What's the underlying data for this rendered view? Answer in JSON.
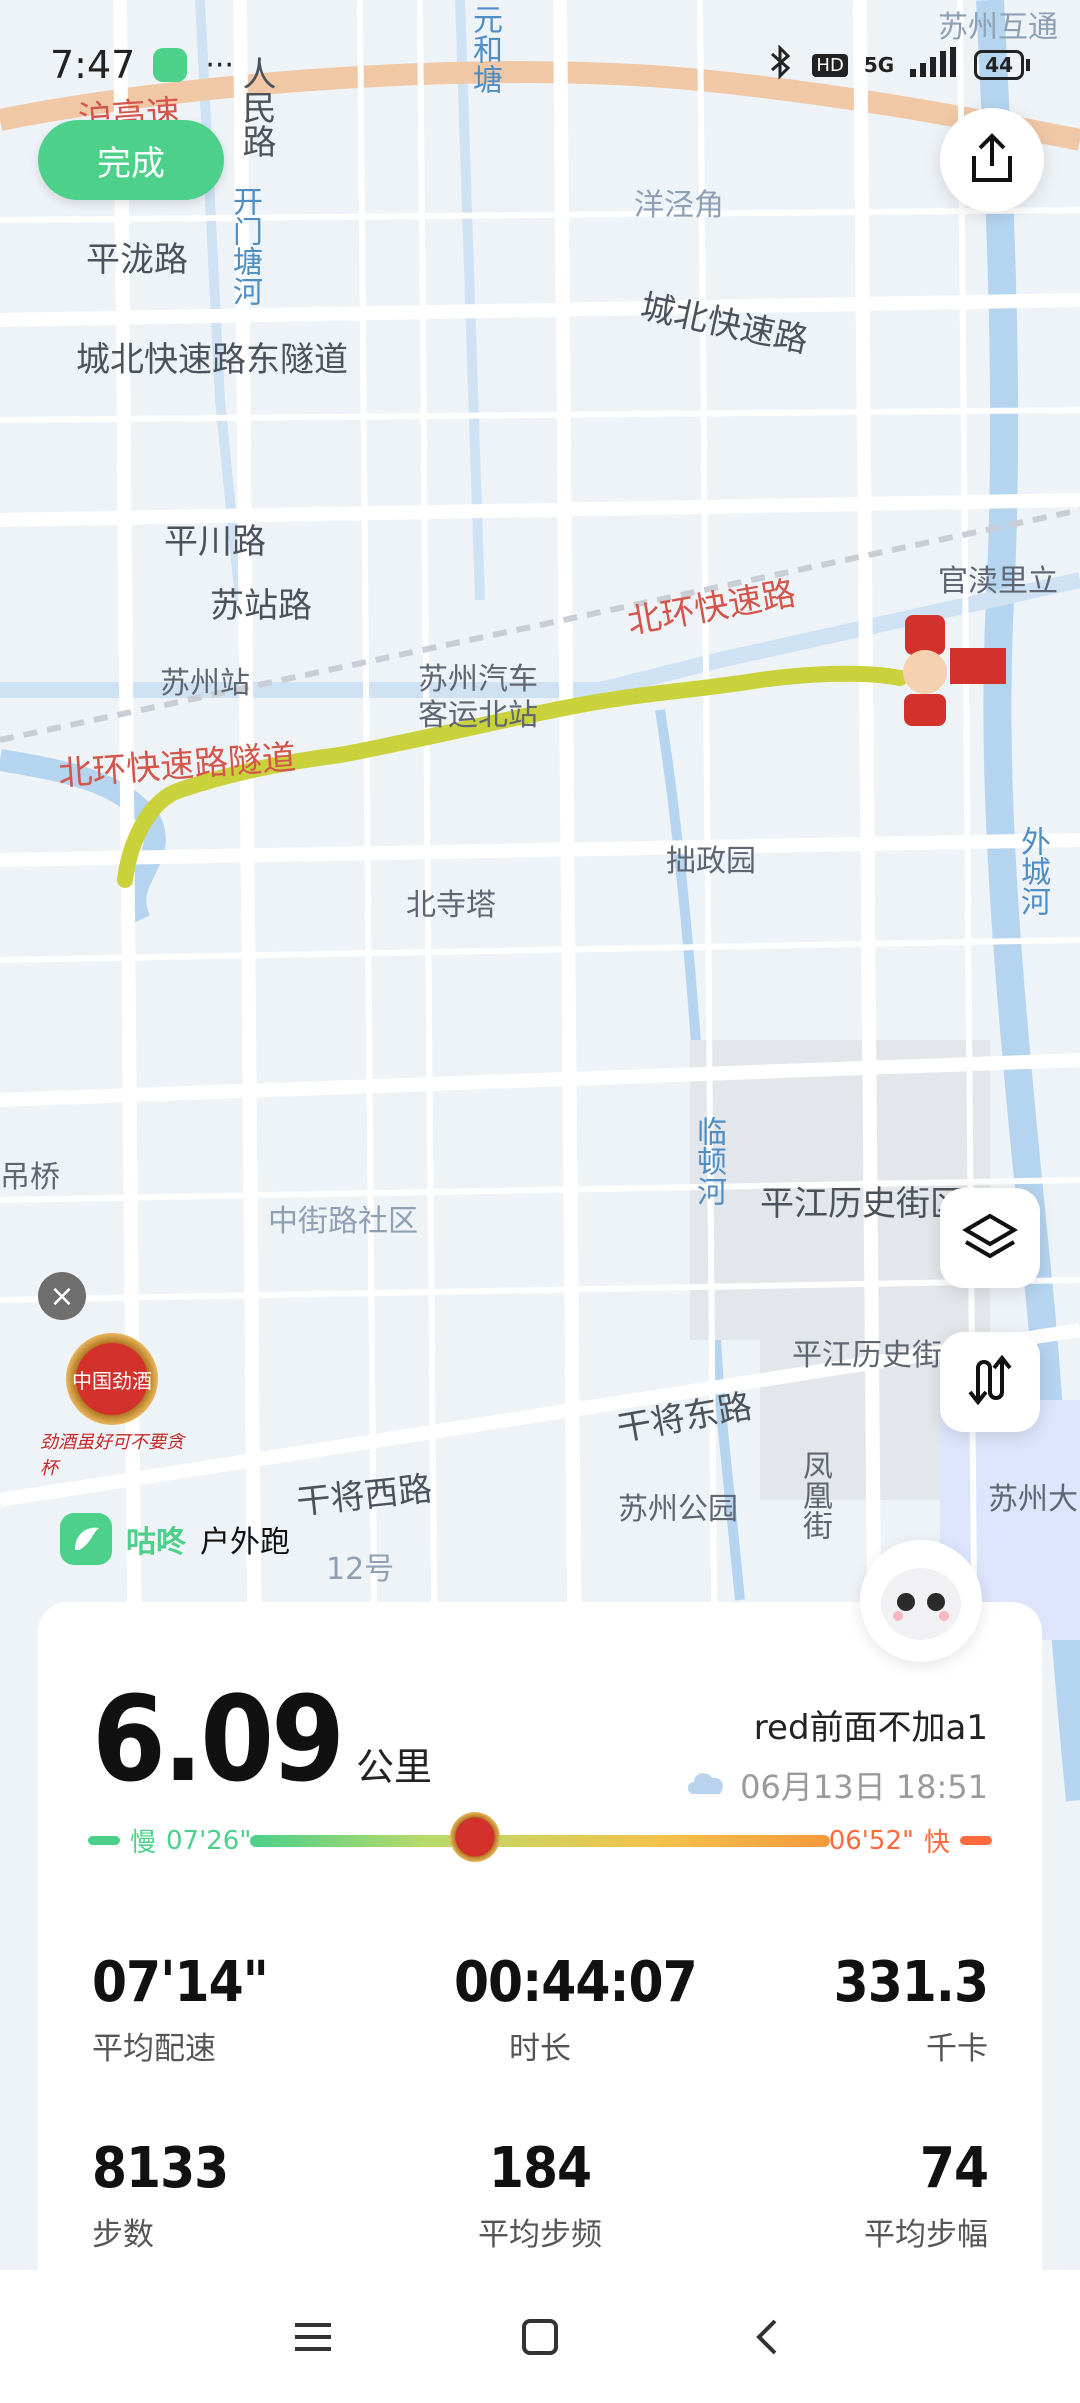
{
  "status_bar": {
    "time": "7:47",
    "more": "···",
    "network": "5G",
    "hd": "HD",
    "battery": "44"
  },
  "actions": {
    "done_label": "完成"
  },
  "map": {
    "labels": [
      {
        "id": "l1",
        "text": "苏州互通"
      },
      {
        "id": "l2",
        "text": "元和塘"
      },
      {
        "id": "l3",
        "text": "沪高速"
      },
      {
        "id": "l4",
        "text": "人民路"
      },
      {
        "id": "l5",
        "text": "开门塘河"
      },
      {
        "id": "l6",
        "text": "洋泾角"
      },
      {
        "id": "l7",
        "text": "平泷路"
      },
      {
        "id": "l8",
        "text": "城北快速路"
      },
      {
        "id": "l9",
        "text": "城北快速路东隧道"
      },
      {
        "id": "l10",
        "text": "平川路"
      },
      {
        "id": "l11",
        "text": "苏站路"
      },
      {
        "id": "l12",
        "text": "官渎里立"
      },
      {
        "id": "l13",
        "text": "北环快速路"
      },
      {
        "id": "l14",
        "text": "苏州站"
      },
      {
        "id": "l15",
        "text": "苏州汽车"
      },
      {
        "id": "l16",
        "text": "客运北站"
      },
      {
        "id": "l17",
        "text": "北环快速路隧道"
      },
      {
        "id": "l18",
        "text": "拙政园"
      },
      {
        "id": "l19",
        "text": "外城河"
      },
      {
        "id": "l20",
        "text": "北寺塔"
      },
      {
        "id": "l21",
        "text": "临顿河"
      },
      {
        "id": "l22",
        "text": "平江历史街区"
      },
      {
        "id": "l23",
        "text": "中街路社区"
      },
      {
        "id": "l24",
        "text": "平江历史街"
      },
      {
        "id": "l25",
        "text": "干将东路"
      },
      {
        "id": "l26",
        "text": "干将西路"
      },
      {
        "id": "l27",
        "text": "苏州公园"
      },
      {
        "id": "l28",
        "text": "凤凰街"
      },
      {
        "id": "l29",
        "text": "苏州大"
      },
      {
        "id": "l30",
        "text": "吊桥"
      },
      {
        "id": "l31",
        "text": "12号"
      }
    ]
  },
  "ad": {
    "badge_text": "中国劲酒",
    "slogan": "劲酒虽好可不要贪杯"
  },
  "brand": {
    "name": "咕咚",
    "mode": "户外跑"
  },
  "summary": {
    "distance": "6.09",
    "distance_unit": "公里",
    "run_title": "red前面不加a1",
    "date": "06月13日 18:51",
    "pace_slow_label": "慢",
    "pace_slow_value": "07'26\"",
    "pace_fast_label": "快",
    "pace_fast_value": "06'52\""
  },
  "stats": [
    {
      "value": "07'14\"",
      "label": "平均配速"
    },
    {
      "value": "00:44:07",
      "label": "时长"
    },
    {
      "value": "331.3",
      "label": "千卡"
    },
    {
      "value": "8133",
      "label": "步数"
    },
    {
      "value": "184",
      "label": "平均步频"
    },
    {
      "value": "74",
      "label": "平均步幅"
    }
  ],
  "colors": {
    "accent": "#4cd08a",
    "route": "#c9d13b",
    "road_label": "#d4564a",
    "fast": "#ff6a3d"
  }
}
